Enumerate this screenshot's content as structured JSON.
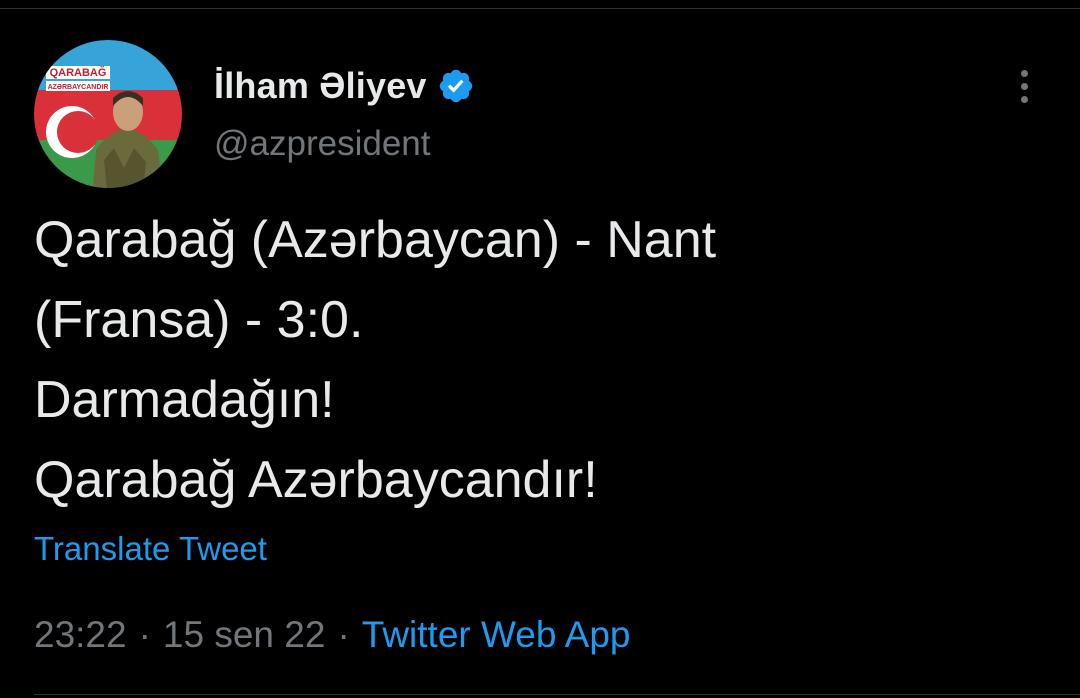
{
  "tweet": {
    "author": {
      "display_name": "İlham Əliyev",
      "handle": "@azpresident",
      "verified_icon": "verified-badge-icon",
      "avatar_text_top": "QARABAĞ",
      "avatar_text_bottom": "AZƏRBAYCANDIR"
    },
    "text_lines": [
      "Qarabağ (Azərbaycan) - Nant",
      "(Fransa) - 3:0.",
      "Darmadağın!",
      "Qarabağ Azərbaycandır!"
    ],
    "translate_label": "Translate Tweet",
    "time": "23:22",
    "date": "15 sen 22",
    "separator": "·",
    "source": "Twitter Web App"
  },
  "colors": {
    "background": "#000000",
    "text": "#e7e9ea",
    "secondary": "#71767b",
    "accent": "#1d9bf0"
  },
  "icons": {
    "more": "more-options-icon",
    "verified": "verified-badge-icon"
  }
}
